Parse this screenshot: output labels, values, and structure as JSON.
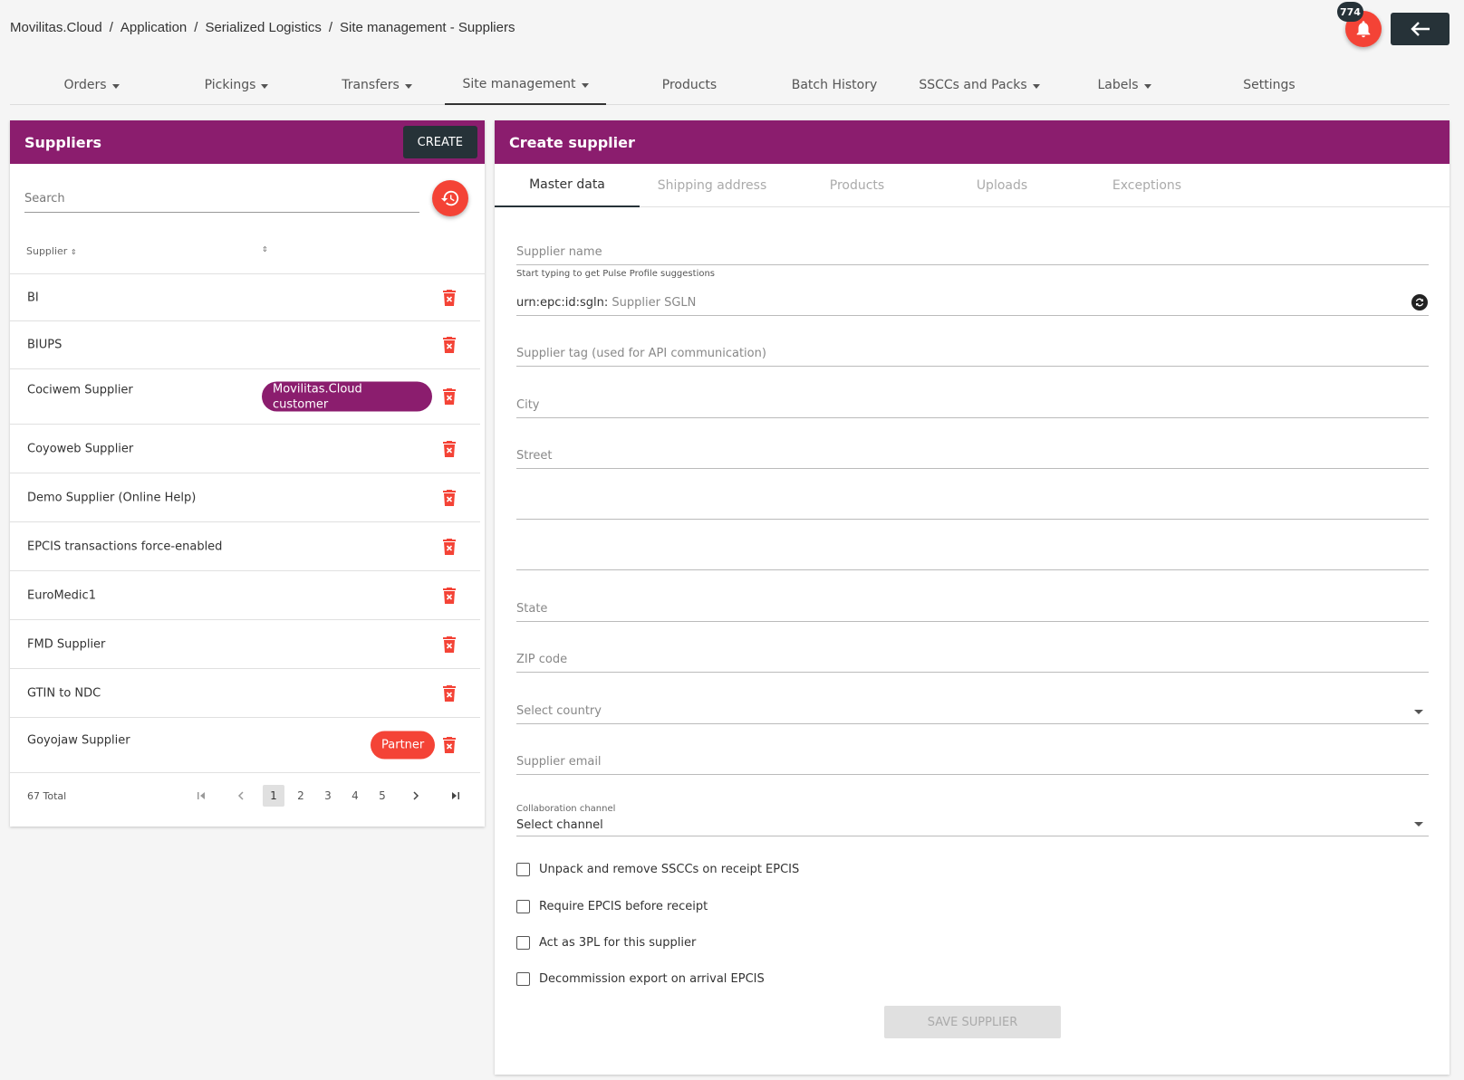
{
  "breadcrumb": [
    "Movilitas.Cloud",
    "Application",
    "Serialized Logistics",
    "Site management - Suppliers"
  ],
  "notifications": {
    "count": "774"
  },
  "nav": [
    {
      "label": "Orders",
      "caret": true
    },
    {
      "label": "Pickings",
      "caret": true
    },
    {
      "label": "Transfers",
      "caret": true
    },
    {
      "label": "Site management",
      "caret": true,
      "active": true
    },
    {
      "label": "Products",
      "caret": false
    },
    {
      "label": "Batch History",
      "caret": false
    },
    {
      "label": "SSCCs and Packs",
      "caret": true
    },
    {
      "label": "Labels",
      "caret": true
    },
    {
      "label": "Settings",
      "caret": false
    }
  ],
  "suppliers_panel": {
    "title": "Suppliers",
    "create_label": "CREATE",
    "search_placeholder": "Search",
    "column_supplier": "Supplier",
    "rows": [
      {
        "name": "BI"
      },
      {
        "name": "BIUPS"
      },
      {
        "name": "Cociwem Supplier",
        "chip": "Movilitas.Cloud customer",
        "chip_type": "purple"
      },
      {
        "name": "Coyoweb Supplier"
      },
      {
        "name": "Demo Supplier (Online Help)"
      },
      {
        "name": "EPCIS transactions force-enabled"
      },
      {
        "name": "EuroMedic1"
      },
      {
        "name": "FMD Supplier"
      },
      {
        "name": "GTIN to NDC"
      },
      {
        "name": "Goyojaw Supplier",
        "chip": "Partner",
        "chip_type": "red"
      }
    ],
    "total": "67 Total",
    "pages": [
      "1",
      "2",
      "3",
      "4",
      "5"
    ],
    "current_page": "1"
  },
  "create_panel": {
    "title": "Create supplier",
    "tabs": [
      "Master data",
      "Shipping address",
      "Products",
      "Uploads",
      "Exceptions"
    ],
    "fields": {
      "supplier_name": "Supplier name",
      "supplier_name_hint": "Start typing to get Pulse Profile suggestions",
      "sgln_prefix": "urn:epc:id:sgln:",
      "sgln_placeholder": "Supplier SGLN",
      "supplier_tag": "Supplier tag (used for API communication)",
      "city": "City",
      "street": "Street",
      "state": "State",
      "zip": "ZIP code",
      "country": "Select country",
      "email": "Supplier email",
      "channel_label": "Collaboration channel",
      "channel_value": "Select channel"
    },
    "checkboxes": [
      "Unpack and remove SSCCs on receipt EPCIS",
      "Require EPCIS before receipt",
      "Act as 3PL for this supplier",
      "Decommission export on arrival EPCIS"
    ],
    "save_label": "SAVE SUPPLIER"
  },
  "colors": {
    "brand": "#8b1d6e",
    "accent": "#f44336",
    "dark": "#263238"
  }
}
